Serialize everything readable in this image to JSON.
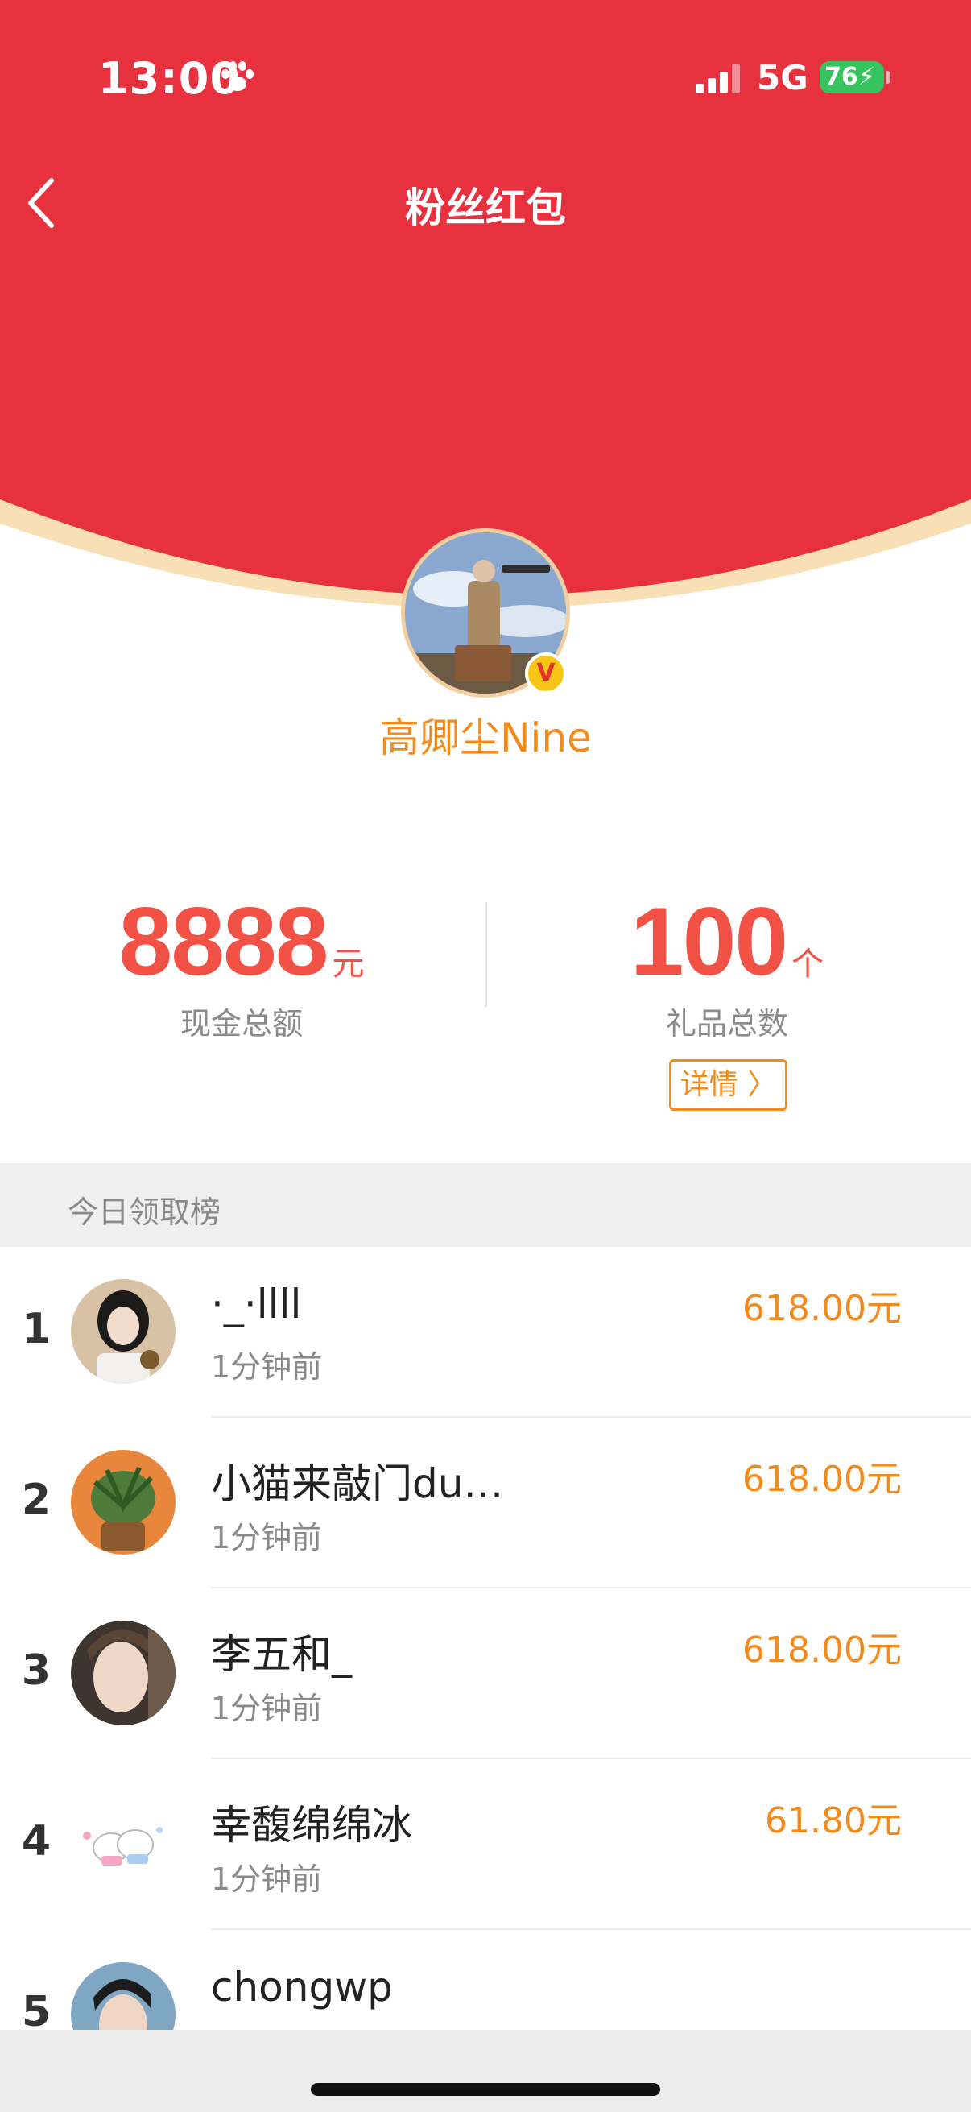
{
  "status_bar": {
    "time": "13:00",
    "paw_icon": "paw-icon",
    "network": "5G",
    "battery": "76"
  },
  "nav": {
    "back_icon": "chevron-left-icon",
    "title": "粉丝红包"
  },
  "host": {
    "name": "高卿尘Nine",
    "badge": "V"
  },
  "stats": {
    "cash_total": "8888",
    "cash_unit": "元",
    "cash_label": "现金总额",
    "gift_total": "100",
    "gift_unit": "个",
    "gift_label": "礼品总数",
    "detail_button": "详情 〉"
  },
  "ranking": {
    "title": "今日领取榜",
    "rows": [
      {
        "rank": "1",
        "name": "·_·llll",
        "time": "1分钟前",
        "amount": "618.00元"
      },
      {
        "rank": "2",
        "name": "小猫来敲门du…",
        "time": "1分钟前",
        "amount": "618.00元"
      },
      {
        "rank": "3",
        "name": "李五和_",
        "time": "1分钟前",
        "amount": "618.00元"
      },
      {
        "rank": "4",
        "name": "幸馥绵绵冰",
        "time": "1分钟前",
        "amount": "61.80元"
      },
      {
        "rank": "5",
        "name": "chongwp",
        "time": "",
        "amount": ""
      }
    ]
  },
  "colors": {
    "header_red": "#e8313f",
    "accent_orange": "#f28a1c",
    "stat_red": "#f25245",
    "battery_green": "#37c45e"
  }
}
